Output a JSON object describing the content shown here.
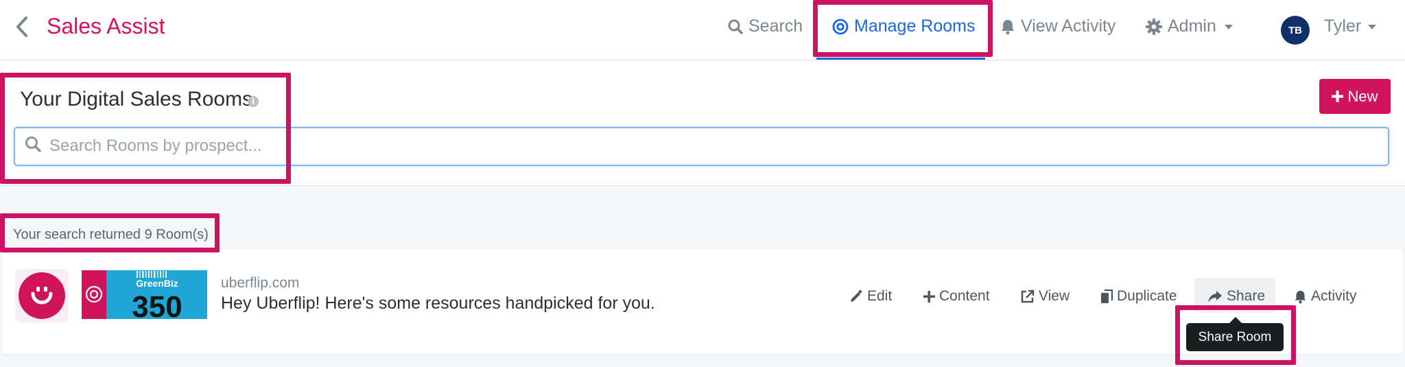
{
  "app": {
    "title": "Sales Assist"
  },
  "nav": {
    "items": [
      {
        "label": "Search",
        "icon": "search-icon"
      },
      {
        "label": "Manage Rooms",
        "icon": "target-icon",
        "active": true
      },
      {
        "label": "View Activity",
        "icon": "bell-icon"
      },
      {
        "label": "Admin",
        "icon": "gear-icon",
        "dropdown": true
      }
    ],
    "user": {
      "initials": "TB",
      "name": "Tyler"
    }
  },
  "page": {
    "title": "Your Digital Sales Rooms",
    "info_icon": "i",
    "new_button": "New",
    "search_placeholder": "Search Rooms by prospect..."
  },
  "results": {
    "summary": "Your search returned 9 Room(s)"
  },
  "rooms": [
    {
      "domain": "uberflip.com",
      "message": "Hey Uberflip! Here's some resources handpicked for you.",
      "thumbnail": {
        "brand": "GreenBiz",
        "number": "350"
      },
      "actions": [
        {
          "label": "Edit",
          "icon": "pencil-icon"
        },
        {
          "label": "Content",
          "icon": "plus-icon"
        },
        {
          "label": "View",
          "icon": "external-link-icon"
        },
        {
          "label": "Duplicate",
          "icon": "copy-icon"
        },
        {
          "label": "Share",
          "icon": "share-icon"
        },
        {
          "label": "Activity",
          "icon": "bell-icon"
        }
      ],
      "tooltip": "Share Room"
    }
  ],
  "colors": {
    "brand": "#d0135b",
    "active_nav": "#1a66e0",
    "highlight": "#cc1363",
    "avatar": "#0f2f6b"
  }
}
